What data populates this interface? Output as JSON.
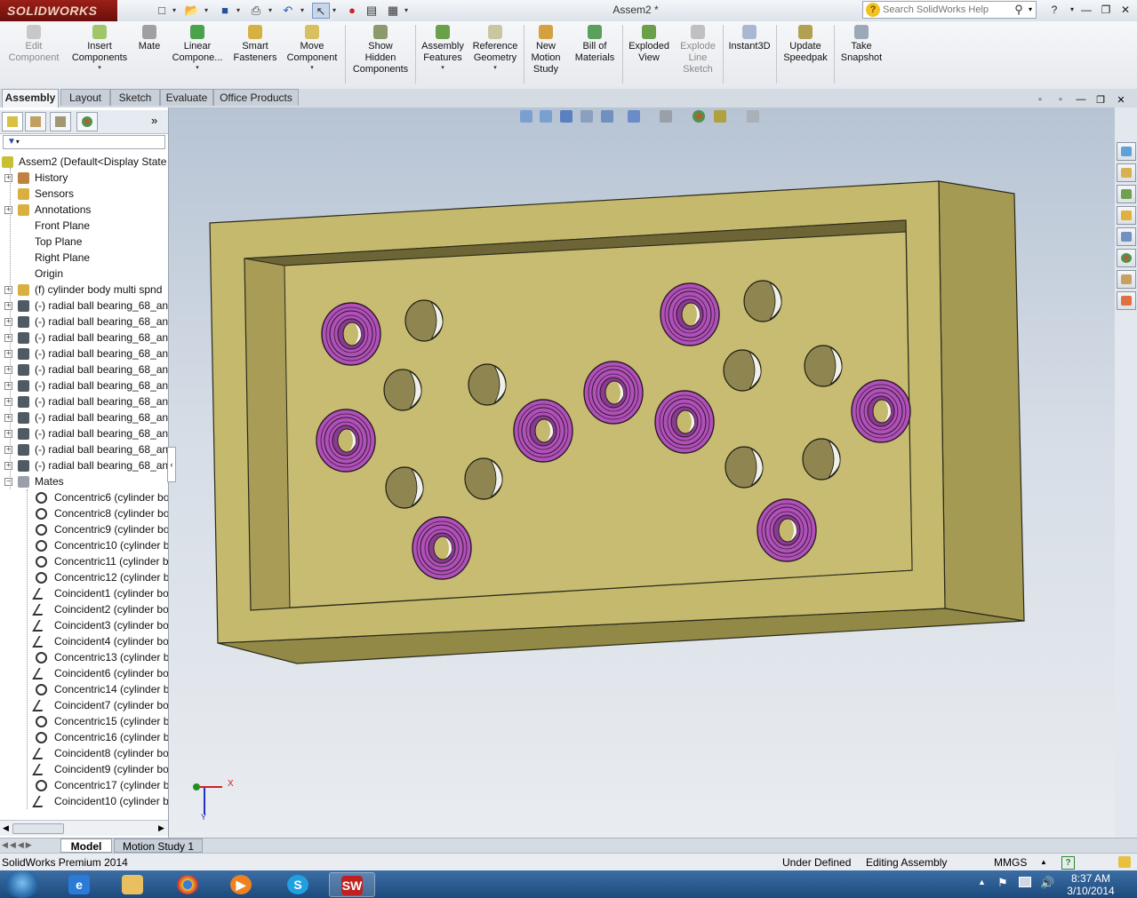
{
  "app": {
    "logo_text": "SOLIDWORKS",
    "document_title": "Assem2 *",
    "search_placeholder": "Search SolidWorks Help"
  },
  "command_manager": {
    "buttons": [
      {
        "label": "Edit\nComponent",
        "enabled": false
      },
      {
        "label": "Insert\nComponents",
        "enabled": true
      },
      {
        "label": "Mate",
        "enabled": true
      },
      {
        "label": "Linear\nCompone...",
        "enabled": true
      },
      {
        "label": "Smart\nFasteners",
        "enabled": true
      },
      {
        "label": "Move\nComponent",
        "enabled": true
      },
      {
        "label": "Show\nHidden\nComponents",
        "enabled": true
      },
      {
        "label": "Assembly\nFeatures",
        "enabled": true
      },
      {
        "label": "Reference\nGeometry",
        "enabled": true
      },
      {
        "label": "New\nMotion\nStudy",
        "enabled": true
      },
      {
        "label": "Bill of\nMaterials",
        "enabled": true
      },
      {
        "label": "Exploded\nView",
        "enabled": true
      },
      {
        "label": "Explode\nLine\nSketch",
        "enabled": false
      },
      {
        "label": "Instant3D",
        "enabled": true
      },
      {
        "label": "Update\nSpeedpak",
        "enabled": true
      },
      {
        "label": "Take\nSnapshot",
        "enabled": true
      }
    ]
  },
  "tabs": [
    "Assembly",
    "Layout",
    "Sketch",
    "Evaluate",
    "Office Products"
  ],
  "active_tab": "Assembly",
  "feature_tree": {
    "root": "Assem2  (Default<Display State",
    "items": [
      "History",
      "Sensors",
      "Annotations",
      "Front Plane",
      "Top Plane",
      "Right Plane",
      "Origin",
      "(f) cylinder body multi spnd",
      "(-) radial ball bearing_68_an",
      "(-) radial ball bearing_68_an",
      "(-) radial ball bearing_68_an",
      "(-) radial ball bearing_68_an",
      "(-) radial ball bearing_68_an",
      "(-) radial ball bearing_68_an",
      "(-) radial ball bearing_68_an",
      "(-) radial ball bearing_68_an",
      "(-) radial ball bearing_68_an",
      "(-) radial ball bearing_68_an",
      "(-) radial ball bearing_68_an",
      "Mates"
    ],
    "mates": [
      "Concentric6 (cylinder bo",
      "Concentric8 (cylinder bo",
      "Concentric9 (cylinder bo",
      "Concentric10 (cylinder b",
      "Concentric11 (cylinder b",
      "Concentric12 (cylinder b",
      "Coincident1 (cylinder bo",
      "Coincident2 (cylinder bo",
      "Coincident3 (cylinder bo",
      "Coincident4 (cylinder bo",
      "Concentric13 (cylinder b",
      "Coincident6 (cylinder bo",
      "Concentric14 (cylinder b",
      "Coincident7 (cylinder bo",
      "Concentric15 (cylinder b",
      "Concentric16 (cylinder b",
      "Coincident8 (cylinder bo",
      "Coincident9 (cylinder bo",
      "Concentric17 (cylinder b",
      "Coincident10 (cylinder b"
    ]
  },
  "bottom_tabs": [
    "Model",
    "Motion Study 1"
  ],
  "status_bar": {
    "product": "SolidWorks Premium 2014",
    "definition": "Under Defined",
    "mode": "Editing Assembly",
    "units": "MMGS"
  },
  "taskbar": {
    "time": "8:37 AM",
    "date": "3/10/2014"
  },
  "triad": {
    "x_label": "X",
    "y_label": "Y"
  },
  "colors": {
    "body_top": "#c5b96e",
    "body_side": "#a99d56",
    "bearing": "#b050b8",
    "hole": "#8f8550"
  }
}
